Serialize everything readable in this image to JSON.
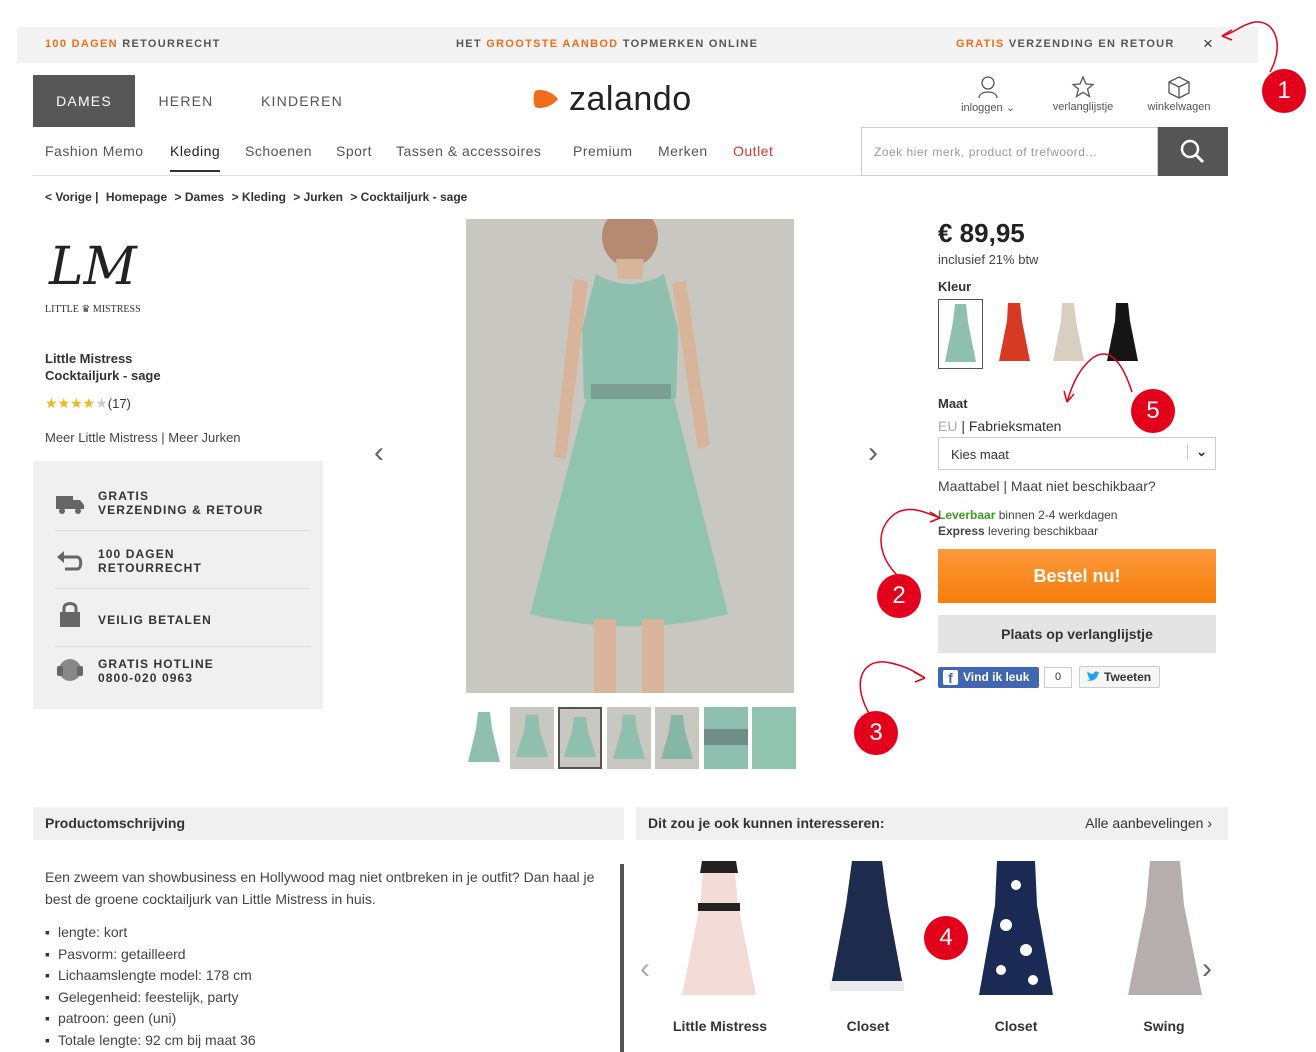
{
  "topbar": {
    "left_highlight": "100 DAGEN",
    "left_rest": " RETOURRECHT",
    "center_pre": "HET ",
    "center_highlight": "GROOTSTE AANBOD",
    "center_rest": " TOPMERKEN ONLINE",
    "right_highlight": "GRATIS",
    "right_rest": " VERZENDING EN RETOUR",
    "close": "×"
  },
  "header": {
    "tabs": [
      "DAMES",
      "HEREN",
      "KINDEREN"
    ],
    "logo": "zalando",
    "account_label": "inloggen",
    "wishlist_label": "verlanglijstje",
    "cart_label": "winkelwagen"
  },
  "nav": {
    "items": [
      "Fashion Memo",
      "Kleding",
      "Schoenen",
      "Sport",
      "Tassen & accessoires",
      "Premium",
      "Merken",
      "Outlet"
    ],
    "search_placeholder": "Zoek hier merk, product of trefwoord..."
  },
  "breadcrumb": [
    "< Vorige |",
    "Homepage",
    "> Dames",
    "> Kleding",
    "> Jurken",
    "> Cocktailjurk - sage"
  ],
  "product": {
    "brand_logo_initials": "LM",
    "brand_logo_name": "LITTLE ♛ MISTRESS",
    "brand": "Little Mistress",
    "name": "Cocktailjurk - sage",
    "stars": "★★★★",
    "star_empty": "★",
    "review_count": "(17)",
    "rating": 4,
    "more_links": "Meer Little Mistress | Meer Jurken",
    "price": "€ 89,95",
    "vat": "inclusief 21% btw",
    "color_label": "Kleur",
    "size_label": "Maat",
    "size_eu": "EU",
    "size_system": " | Fabrieksmaten",
    "size_select": "Kies maat",
    "size_links": "Maattabel | Maat niet beschikbaar?",
    "delivery_status": "Leverbaar",
    "delivery_time": " binnen 2-4 werkdagen",
    "express_bold": "Express",
    "express_rest": " levering beschikbaar",
    "order_button": "Bestel nu!",
    "wishlist_button": "Plaats op verlanglijstje",
    "fb_like": "Vind ik leuk",
    "fb_count": "0",
    "tweet": "Tweeten"
  },
  "usps": [
    {
      "line1": "GRATIS",
      "line2": "VERZENDING & RETOUR"
    },
    {
      "line1": "100 DAGEN",
      "line2": "RETOURRECHT"
    },
    {
      "line1": "VEILIG BETALEN",
      "line2": ""
    },
    {
      "line1": "GRATIS HOTLINE",
      "line2": "0800-020 0963"
    }
  ],
  "gallery": {
    "prev": "‹",
    "next": "›"
  },
  "description": {
    "heading": "Productomschrijving",
    "text": "Een zweem van showbusiness en Hollywood mag niet ontbreken in je outfit? Dan haal je best de groene cocktailjurk van Little Mistress in huis.",
    "specs": [
      "lengte: kort",
      "Pasvorm: getailleerd",
      "Lichaamslengte model: 178 cm",
      "Gelegenheid: feestelijk, party",
      "patroon: geen (uni)",
      "Totale lengte: 92 cm bij maat 36"
    ]
  },
  "recommendations": {
    "heading": "Dit zou je ook kunnen interesseren:",
    "all_link": "Alle aanbevelingen ›",
    "items": [
      "Little Mistress",
      "Closet",
      "Closet",
      "Swing"
    ],
    "prev": "‹",
    "next": "›"
  },
  "annotations": [
    "1",
    "2",
    "3",
    "4",
    "5"
  ],
  "colors": {
    "accent": "#f06e1b",
    "order": "#f7870f",
    "marker": "#e3001b",
    "green": "#3a9d23",
    "outlet": "#d13a2a",
    "dress": "#8fbfae"
  }
}
